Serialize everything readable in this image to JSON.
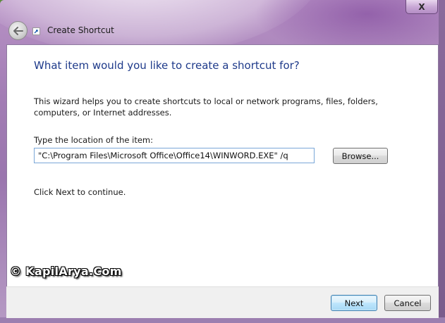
{
  "window": {
    "title": "Create Shortcut",
    "close_symbol": "X",
    "back_icon": "back-arrow-icon",
    "title_icon": "shortcut-icon"
  },
  "wizard": {
    "heading": "What item would you like to create a shortcut for?",
    "description": "This wizard helps you to create shortcuts to local or network programs, files, folders, computers, or Internet addresses.",
    "location_label": "Type the location of the item:",
    "location_value": "\"C:\\Program Files\\Microsoft Office\\Office14\\WINWORD.EXE\" /q",
    "browse_label": "Browse...",
    "continue_text": "Click Next to continue."
  },
  "footer": {
    "next_label": "Next",
    "cancel_label": "Cancel"
  },
  "watermark": {
    "text": "© KapilArya.Com"
  },
  "colors": {
    "heading": "#1e3a8a",
    "frame": "#a27db4",
    "input_border": "#7aa7d8",
    "default_button_border": "#3c7fb1"
  }
}
